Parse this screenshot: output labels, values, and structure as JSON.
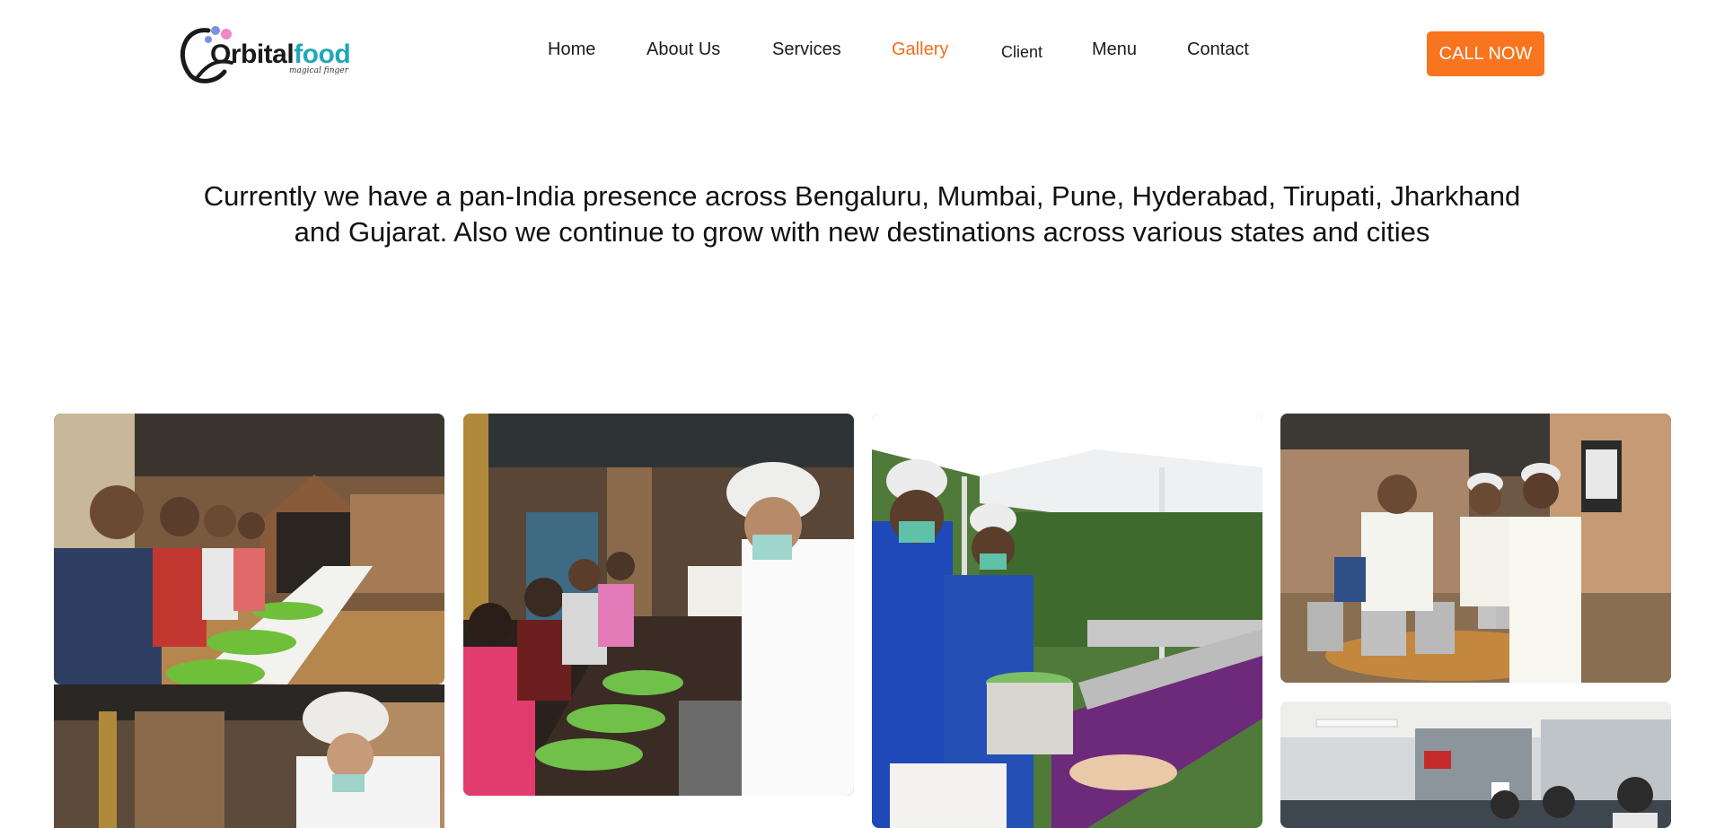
{
  "brand": {
    "name_part1": "Orbital",
    "name_part2": "food",
    "tagline": "magical finger",
    "colors": {
      "teal": "#1fa7b8",
      "dark": "#1a1a1a",
      "dot_blue": "#7b8fe8",
      "dot_pink": "#ef86c6"
    }
  },
  "nav": {
    "items": [
      "Home",
      "About Us",
      "Services",
      "Gallery",
      "Client",
      "Menu",
      "Contact"
    ],
    "active": "Gallery",
    "active_color": "#f26d1d",
    "cta_label": "CALL NOW",
    "cta_color": "#f9741e"
  },
  "headline": "Currently we have a pan-India presence across Bengaluru, Mumbai, Pune, Hyderabad, Tirupati, Jharkhand and Gujarat. Also we continue to grow with new destinations across various states and cities",
  "gallery": {
    "photos": [
      {
        "icon": "photo-icon",
        "subject": "guests-at-banana-leaf-table"
      },
      {
        "icon": "photo-icon",
        "subject": "server-in-hairnet-plating"
      },
      {
        "icon": "photo-icon",
        "subject": "guests-and-server-at-table"
      },
      {
        "icon": "photo-icon",
        "subject": "catering-staff-under-tent"
      },
      {
        "icon": "photo-icon",
        "subject": "staff-with-steel-buckets"
      },
      {
        "icon": "photo-icon",
        "subject": "canteen-dining-hall"
      }
    ]
  }
}
